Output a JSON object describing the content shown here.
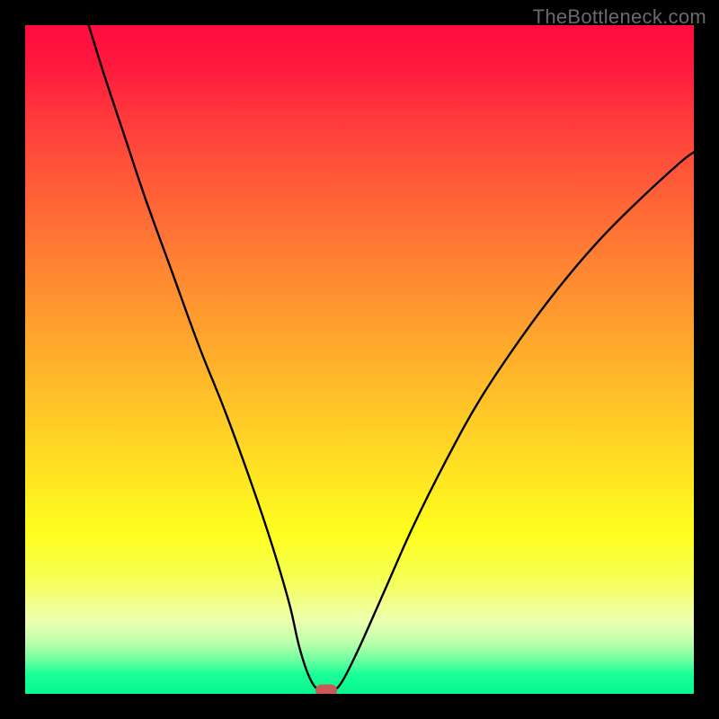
{
  "watermark": "TheBottleneck.com",
  "colors": {
    "frame": "#000000",
    "curve": "#000000",
    "marker": "#c95a57",
    "gradient_top": "#ff0b3f",
    "gradient_mid": "#feff1e",
    "gradient_bottom": "#07f78f"
  },
  "chart_data": {
    "type": "line",
    "title": "",
    "xlabel": "",
    "ylabel": "",
    "xlim": [
      0,
      100
    ],
    "ylim": [
      0,
      100
    ],
    "grid": false,
    "series": [
      {
        "name": "bottleneck-curve",
        "x": [
          9.5,
          12,
          15,
          18,
          22,
          26,
          30,
          34,
          37,
          39.5,
          41,
          42.5,
          44,
          46,
          47.5,
          50,
          54,
          58,
          63,
          68,
          74,
          80,
          86,
          92,
          98,
          100
        ],
        "y": [
          100,
          92,
          83,
          74,
          63,
          52,
          42,
          31,
          22,
          13.5,
          7,
          2.5,
          0.5,
          0.5,
          2,
          7,
          16,
          25,
          35,
          44,
          53,
          61,
          68,
          74,
          79.5,
          81
        ]
      }
    ],
    "annotations": [
      {
        "name": "optimal-marker",
        "x": 45,
        "y": 0.5
      }
    ],
    "background": {
      "type": "vertical-gradient",
      "stops": [
        {
          "pos": 0.0,
          "color": "#ff0b3f"
        },
        {
          "pos": 0.24,
          "color": "#ff5c38"
        },
        {
          "pos": 0.55,
          "color": "#ffbf29"
        },
        {
          "pos": 0.76,
          "color": "#feff1e"
        },
        {
          "pos": 0.92,
          "color": "#baffab"
        },
        {
          "pos": 1.0,
          "color": "#07f78f"
        }
      ]
    }
  }
}
